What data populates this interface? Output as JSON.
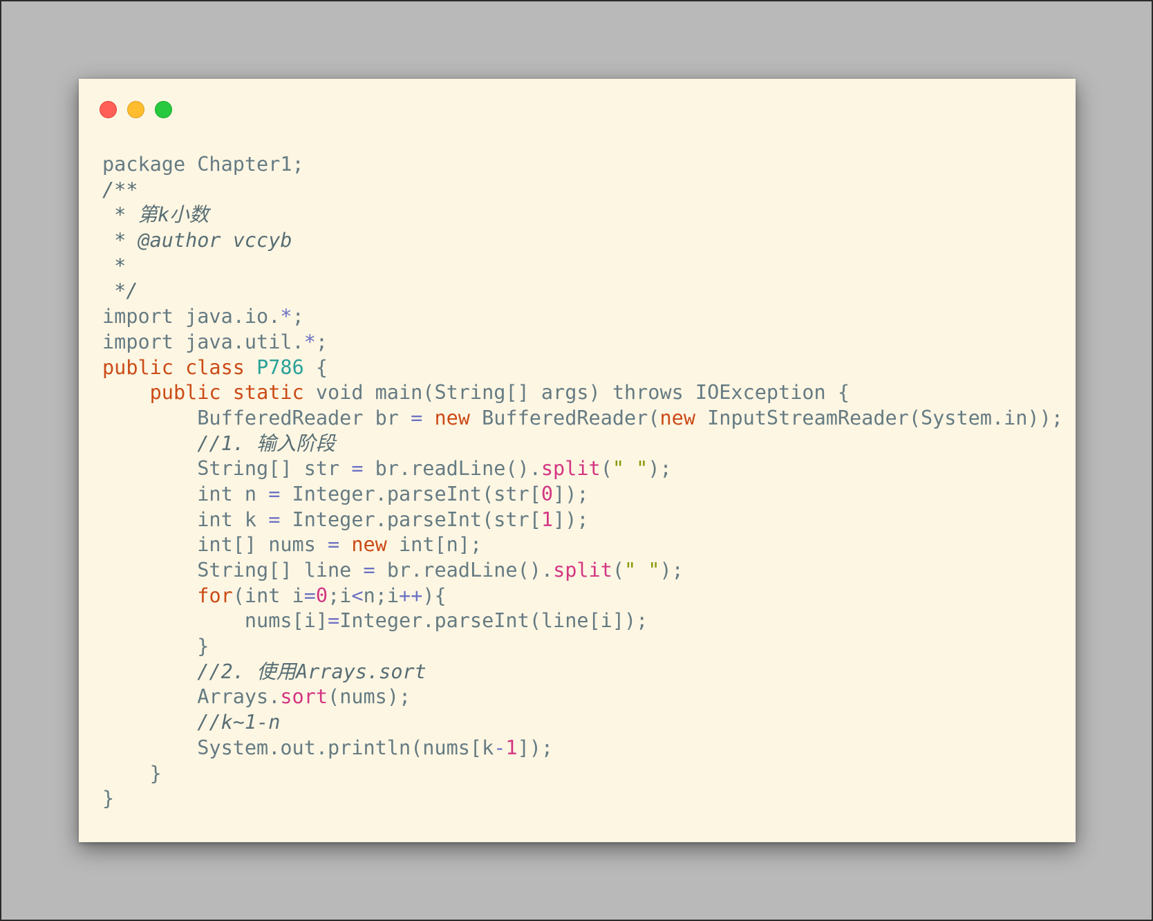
{
  "window": {
    "buttons": {
      "close_color": "#ff5f56",
      "minimize_color": "#ffbd2e",
      "maximize_color": "#27c93f"
    }
  },
  "code_lines": [
    [
      {
        "t": "package Chapter1;",
        "c": "tx"
      }
    ],
    [
      {
        "t": "/**",
        "c": "cm"
      }
    ],
    [
      {
        "t": " * 第k小数",
        "c": "cm"
      }
    ],
    [
      {
        "t": " * @author vccyb",
        "c": "cm"
      }
    ],
    [
      {
        "t": " *",
        "c": "cm"
      }
    ],
    [
      {
        "t": " */",
        "c": "cm"
      }
    ],
    [
      {
        "t": "import java.io.",
        "c": "tx"
      },
      {
        "t": "*",
        "c": "op"
      },
      {
        "t": ";",
        "c": "tx"
      }
    ],
    [
      {
        "t": "import java.util.",
        "c": "tx"
      },
      {
        "t": "*",
        "c": "op"
      },
      {
        "t": ";",
        "c": "tx"
      }
    ],
    [
      {
        "t": "public class ",
        "c": "kw"
      },
      {
        "t": "P786",
        "c": "cls"
      },
      {
        "t": " {",
        "c": "tx"
      }
    ],
    [
      {
        "t": "    ",
        "c": "tx"
      },
      {
        "t": "public static",
        "c": "kw"
      },
      {
        "t": " void main(String[] args) throws IOException {",
        "c": "tx"
      }
    ],
    [
      {
        "t": "        BufferedReader br ",
        "c": "tx"
      },
      {
        "t": "=",
        "c": "op"
      },
      {
        "t": " ",
        "c": "tx"
      },
      {
        "t": "new",
        "c": "kw"
      },
      {
        "t": " BufferedReader(",
        "c": "tx"
      },
      {
        "t": "new",
        "c": "kw"
      },
      {
        "t": " InputStreamReader(System.in));",
        "c": "tx"
      }
    ],
    [
      {
        "t": "        ",
        "c": "tx"
      },
      {
        "t": "//1. 输入阶段",
        "c": "cm"
      }
    ],
    [
      {
        "t": "        String[] str ",
        "c": "tx"
      },
      {
        "t": "=",
        "c": "op"
      },
      {
        "t": " br.readLine().",
        "c": "tx"
      },
      {
        "t": "split",
        "c": "fn"
      },
      {
        "t": "(",
        "c": "tx"
      },
      {
        "t": "\" \"",
        "c": "str"
      },
      {
        "t": ");",
        "c": "tx"
      }
    ],
    [
      {
        "t": "        int n ",
        "c": "tx"
      },
      {
        "t": "=",
        "c": "op"
      },
      {
        "t": " Integer.parseInt(str[",
        "c": "tx"
      },
      {
        "t": "0",
        "c": "num"
      },
      {
        "t": "]);",
        "c": "tx"
      }
    ],
    [
      {
        "t": "        int k ",
        "c": "tx"
      },
      {
        "t": "=",
        "c": "op"
      },
      {
        "t": " Integer.parseInt(str[",
        "c": "tx"
      },
      {
        "t": "1",
        "c": "num"
      },
      {
        "t": "]);",
        "c": "tx"
      }
    ],
    [
      {
        "t": "        int[] nums ",
        "c": "tx"
      },
      {
        "t": "=",
        "c": "op"
      },
      {
        "t": " ",
        "c": "tx"
      },
      {
        "t": "new",
        "c": "kw"
      },
      {
        "t": " int[n];",
        "c": "tx"
      }
    ],
    [
      {
        "t": "        String[] line ",
        "c": "tx"
      },
      {
        "t": "=",
        "c": "op"
      },
      {
        "t": " br.readLine().",
        "c": "tx"
      },
      {
        "t": "split",
        "c": "fn"
      },
      {
        "t": "(",
        "c": "tx"
      },
      {
        "t": "\" \"",
        "c": "str"
      },
      {
        "t": ");",
        "c": "tx"
      }
    ],
    [
      {
        "t": "        ",
        "c": "tx"
      },
      {
        "t": "for",
        "c": "kw"
      },
      {
        "t": "(int i",
        "c": "tx"
      },
      {
        "t": "=",
        "c": "op"
      },
      {
        "t": "0",
        "c": "num"
      },
      {
        "t": ";i",
        "c": "tx"
      },
      {
        "t": "<",
        "c": "op"
      },
      {
        "t": "n;i",
        "c": "tx"
      },
      {
        "t": "++",
        "c": "op"
      },
      {
        "t": "){",
        "c": "tx"
      }
    ],
    [
      {
        "t": "            nums[i]",
        "c": "tx"
      },
      {
        "t": "=",
        "c": "op"
      },
      {
        "t": "Integer.parseInt(line[i]);",
        "c": "tx"
      }
    ],
    [
      {
        "t": "        }",
        "c": "tx"
      }
    ],
    [
      {
        "t": "        ",
        "c": "tx"
      },
      {
        "t": "//2. 使用Arrays.sort",
        "c": "cm"
      }
    ],
    [
      {
        "t": "        Arrays.",
        "c": "tx"
      },
      {
        "t": "sort",
        "c": "fn"
      },
      {
        "t": "(nums);",
        "c": "tx"
      }
    ],
    [
      {
        "t": "        ",
        "c": "tx"
      },
      {
        "t": "//k~1-n",
        "c": "cm"
      }
    ],
    [
      {
        "t": "        System.out.println(nums[k",
        "c": "tx"
      },
      {
        "t": "-",
        "c": "op"
      },
      {
        "t": "1",
        "c": "num"
      },
      {
        "t": "]);",
        "c": "tx"
      }
    ],
    [
      {
        "t": "    }",
        "c": "tx"
      }
    ],
    [
      {
        "t": "}",
        "c": "tx"
      }
    ]
  ]
}
